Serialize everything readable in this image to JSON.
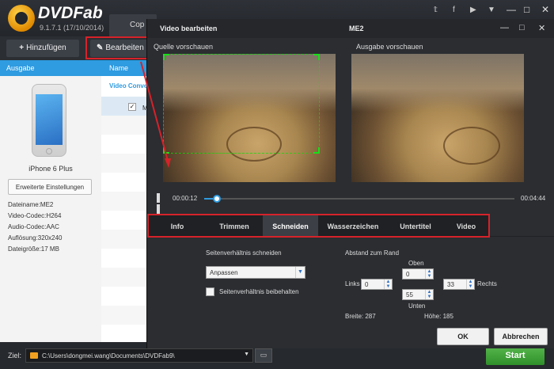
{
  "app": {
    "brand": "DVDFab",
    "version": "9.1.7.1 (17/10/2014)",
    "copy_tab": "Cop",
    "social_icons": [
      "twitter-icon",
      "facebook-icon",
      "youtube-icon",
      "dropdown-icon"
    ],
    "window_controls": [
      "minimize-icon",
      "maximize-icon",
      "close-icon"
    ]
  },
  "toolbar": {
    "add_label": "Hinzufügen",
    "edit_label": "Bearbeiten"
  },
  "left_panel": {
    "header": "Ausgabe",
    "device": "iPhone 6 Plus",
    "advanced_button": "Erweiterte Einstellungen",
    "info": [
      "Dateiname:ME2",
      "Video-Codec:H264",
      "Audio-Codec:AAC",
      "Auflösung:320x240",
      "Dateigröße:17 MB"
    ]
  },
  "middle_panel": {
    "header": "Name",
    "title": "Video Conve",
    "row_item": "M",
    "checkbox_mark": "✓"
  },
  "bottom_bar": {
    "ziel_label": "Ziel:",
    "path": "C:\\Users\\dongmei.wang\\Documents\\DVDFab9\\",
    "browse_icon": "folder-open-icon",
    "start": "Start"
  },
  "dialog": {
    "title": "Video bearbeiten",
    "filename": "ME2",
    "source_preview": "Quelle vorschauen",
    "output_preview": "Ausgabe vorschauen",
    "time_current": "00:00:12",
    "time_total": "00:04:44",
    "progress": 0.042,
    "tabs": [
      "Info",
      "Trimmen",
      "Schneiden",
      "Wasserzeichen",
      "Untertitel",
      "Video"
    ],
    "active_tab": "Schneiden",
    "crop": {
      "ratio_label": "Seitenverhältnis schneiden",
      "ratio_value": "Anpassen",
      "keep_ratio_label": "Seitenverhältnis beibehalten",
      "margin_label": "Abstand zum Rand",
      "top_label": "Oben",
      "top_value": "0",
      "left_label": "Links",
      "left_value": "0",
      "right_label": "Rechts",
      "right_value": "33",
      "bottom_label": "Unten",
      "bottom_value": "55",
      "width_label": "Breite:",
      "width_value": "287",
      "height_label": "Höhe:",
      "height_value": "185"
    },
    "ok": "OK",
    "cancel": "Abbrechen"
  },
  "colors": {
    "accent_blue": "#2f9be0",
    "highlight_red": "#d6222a",
    "start_green": "#3fa336",
    "crop_green": "#19e019"
  }
}
